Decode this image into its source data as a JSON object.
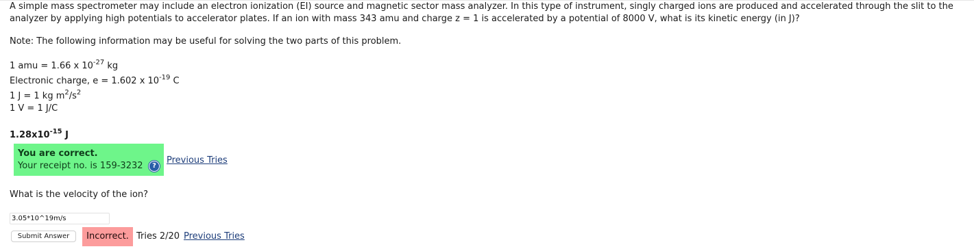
{
  "question": {
    "line1": "A simple mass spectrometer may include an electron ionization (EI) source and magnetic sector mass analyzer. In this type of instrument, singly charged ions are produced and accelerated through the slit to the",
    "line2": "analyzer by applying high potentials to accelerator plates. If an ion with mass 343 amu and charge z = 1 is accelerated by a potential of 8000 V, what is its kinetic energy (in J)?"
  },
  "note": "Note: The following information may be useful for solving the two parts of this problem.",
  "facts": {
    "amu_prefix": "1 amu = 1.66 x 10",
    "amu_exp": "-27",
    "amu_unit": " kg",
    "charge_prefix": "Electronic charge, e = 1.602 x 10",
    "charge_exp": "-19",
    "charge_unit": " C",
    "joule_prefix": "1 J = 1 kg m",
    "joule_exp1": "2",
    "joule_mid": "/s",
    "joule_exp2": "2",
    "volt": "1 V = 1 J/C"
  },
  "part1": {
    "answer_base": "1.28x10",
    "answer_exp": "-15",
    "answer_unit": " J",
    "correct_title": "You are correct.",
    "receipt": "Your receipt no. is 159-3232",
    "help_icon": "question-circle-icon",
    "previous_tries": "Previous Tries"
  },
  "part2": {
    "question": "What is the velocity of the ion?",
    "input_value": "3.05*10^19m/s",
    "submit_label": "Submit Answer",
    "status": "Incorrect.",
    "tries": "Tries 2/20",
    "previous_tries": "Previous Tries"
  },
  "colors": {
    "correct_bg": "#6ef58a",
    "incorrect_bg": "#fc9c9c",
    "link": "#1d3d7a"
  }
}
